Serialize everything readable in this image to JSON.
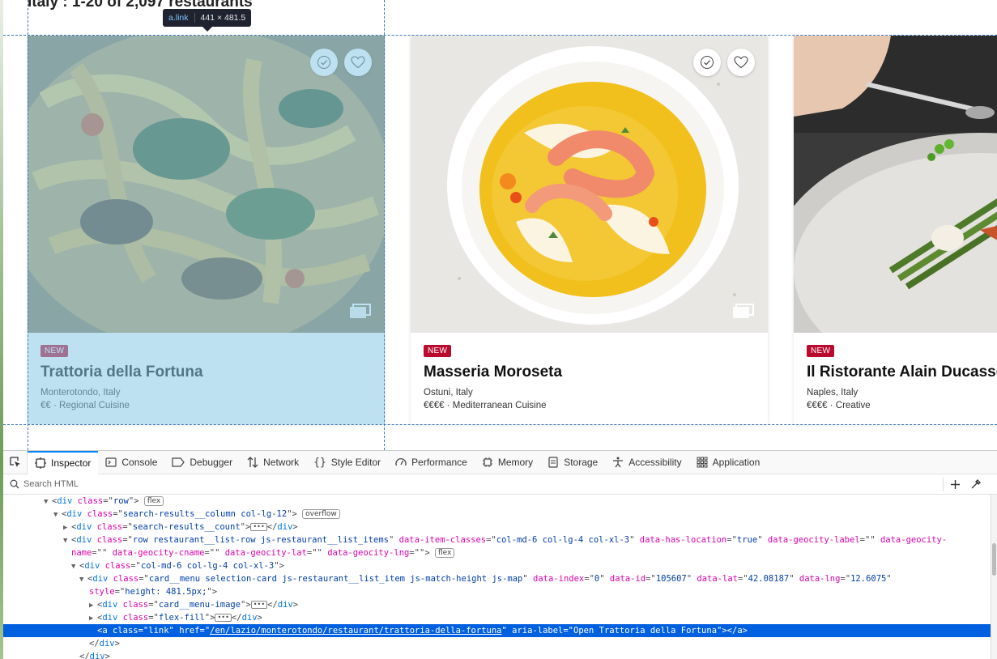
{
  "results_count": "Italy : 1-20 of 2,097 restaurants",
  "inspector_tooltip": {
    "tag": "a.link",
    "size": "441 × 481.5"
  },
  "cards": [
    {
      "badge": "NEW",
      "title": "Trattoria della Fortuna",
      "location": "Monterotondo, Italy",
      "meta": "€€ · Regional Cuisine"
    },
    {
      "badge": "NEW",
      "title": "Masseria Moroseta",
      "location": "Ostuni, Italy",
      "meta": "€€€€ · Mediterranean Cuisine"
    },
    {
      "badge": "NEW",
      "title": "Il Ristorante Alain Ducasse",
      "location": "Naples, Italy",
      "meta": "€€€€ · Creative"
    }
  ],
  "devtools": {
    "tabs": [
      "Inspector",
      "Console",
      "Debugger",
      "Network",
      "Style Editor",
      "Performance",
      "Memory",
      "Storage",
      "Accessibility",
      "Application"
    ],
    "search_placeholder": "Search HTML",
    "badges": {
      "flex": "flex",
      "overflow": "overflow"
    },
    "tree": {
      "l1_tag": "div",
      "l1_class": "row",
      "l2_class": "search-results__column col-lg-12",
      "l3_class": "search-results__count",
      "l4_class": "row restaurant__list-row js-restaurant__list_items",
      "l4_item_classes": "col-md-6 col-lg-4 col-xl-3",
      "l4_has_location": "true",
      "l4_geocity_label": "",
      "l4_geocity_name": "",
      "l4_geocity_cname": "",
      "l4_geocity_lat": "",
      "l4_geocity_lng": "",
      "l5_class": "col-md-6 col-lg-4 col-xl-3",
      "l6_class": "card__menu selection-card js-restaurant__list_item js-match-height js-map",
      "l6_index": "0",
      "l6_id": "105607",
      "l6_lat": "42.08187",
      "l6_lng": "12.6075",
      "l6_style": "height: 481.5px;",
      "l7_class": "card__menu-image",
      "l8_class": "flex-fill",
      "l9_class": "link",
      "l9_href": "/en/lazio/monterotondo/restaurant/trattoria-della-fortuna",
      "l9_aria": "Open Trattoria della Fortuna"
    }
  },
  "colors": {
    "badge": "#ba0b2f",
    "highlight": "#89c8e8",
    "selection": "#0060df",
    "tab_accent": "#0a84ff"
  }
}
